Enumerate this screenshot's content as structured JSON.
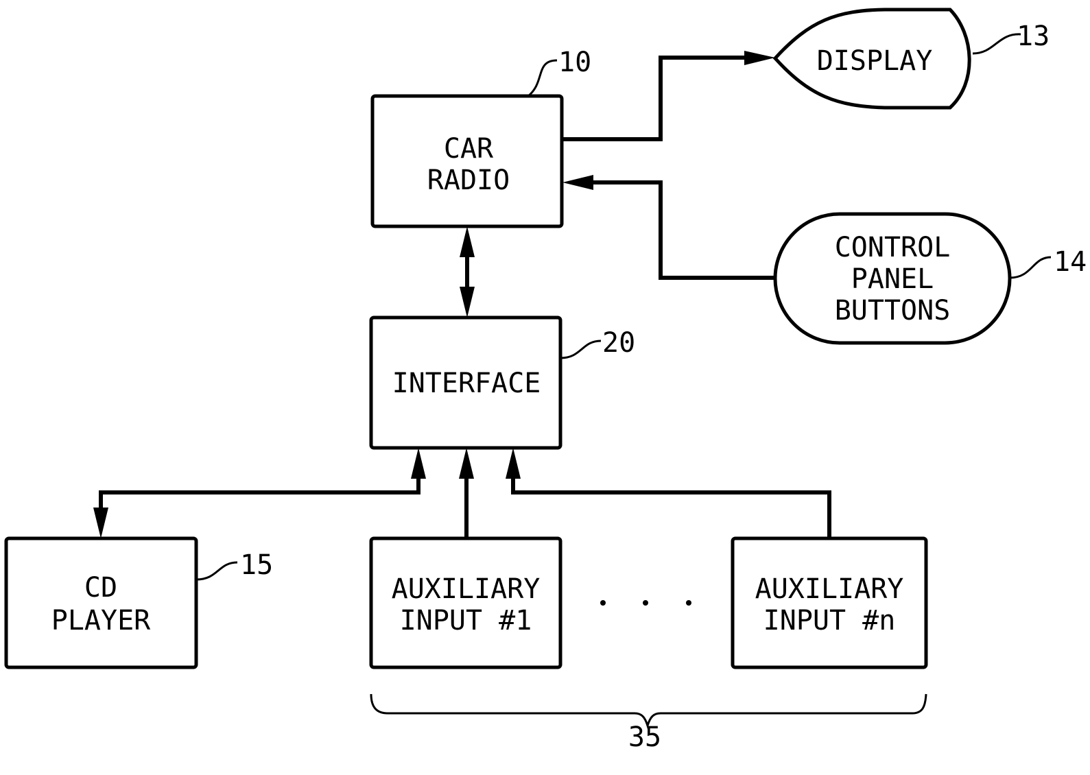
{
  "figure": {
    "blocks": {
      "car_radio": {
        "lines": [
          "CAR",
          "RADIO"
        ],
        "ref": "10"
      },
      "display": {
        "lines": [
          "DISPLAY"
        ],
        "ref": "13"
      },
      "control_panel": {
        "lines": [
          "CONTROL",
          "PANEL",
          "BUTTONS"
        ],
        "ref": "14"
      },
      "interface": {
        "lines": [
          "INTERFACE"
        ],
        "ref": "20"
      },
      "cd_player": {
        "lines": [
          "CD",
          "PLAYER"
        ],
        "ref": "15"
      },
      "aux_1": {
        "lines": [
          "AUXILIARY",
          "INPUT #1"
        ]
      },
      "aux_n": {
        "lines": [
          "AUXILIARY",
          "INPUT #n"
        ]
      }
    },
    "ellipsis": "· · ·",
    "group_ref": "35"
  }
}
